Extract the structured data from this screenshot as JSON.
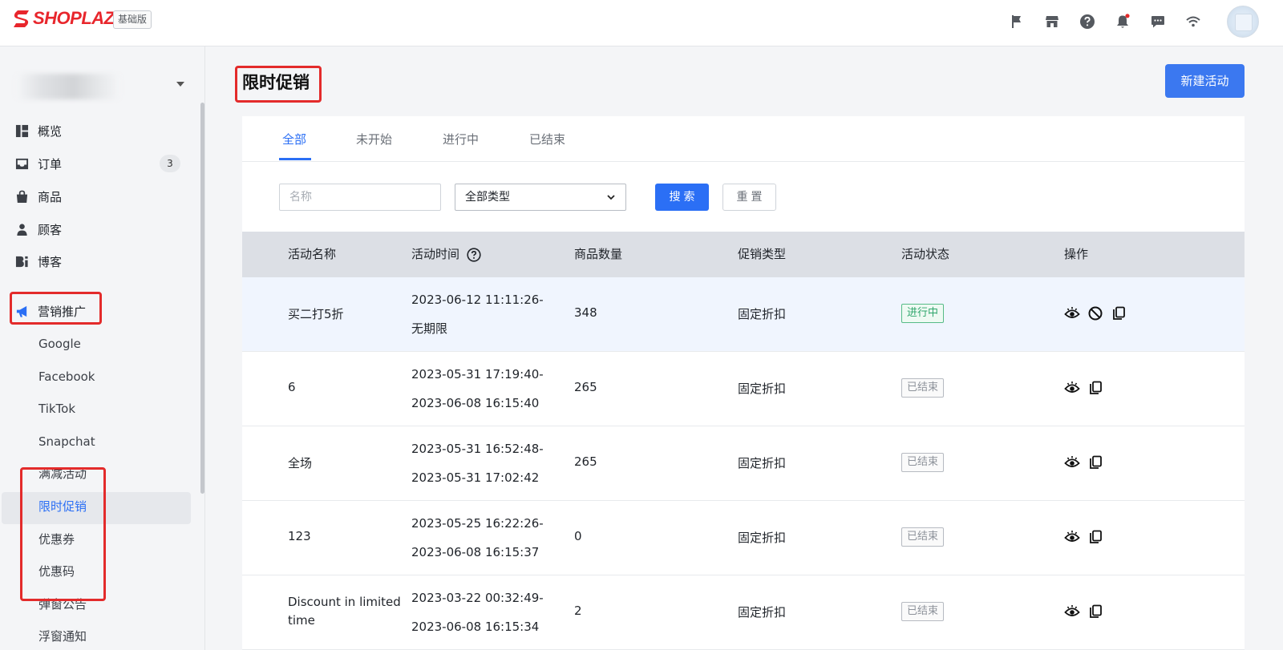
{
  "brand": {
    "name": "SHOPLAZZA",
    "plan": "基础版"
  },
  "topbar": {
    "icons": [
      "flag-icon",
      "store-icon",
      "help-icon",
      "bell-icon",
      "chat-icon",
      "wifi-icon"
    ]
  },
  "sidebar": {
    "nav": [
      {
        "label": "概览",
        "icon": "dashboard-icon"
      },
      {
        "label": "订单",
        "icon": "inbox-icon",
        "badge": "3"
      },
      {
        "label": "商品",
        "icon": "bag-icon"
      },
      {
        "label": "顾客",
        "icon": "person-icon"
      },
      {
        "label": "博客",
        "icon": "blog-icon"
      },
      {
        "label": "营销推广",
        "icon": "megaphone-icon"
      }
    ],
    "marketing_sub": [
      "Google",
      "Facebook",
      "TikTok",
      "Snapchat",
      "满减活动",
      "限时促销",
      "优惠券",
      "优惠码",
      "弹窗公告",
      "浮窗通知"
    ],
    "active_sub": "限时促销"
  },
  "page": {
    "title": "限时促销",
    "new_button": "新建活动"
  },
  "tabs": [
    "全部",
    "未开始",
    "进行中",
    "已结束"
  ],
  "active_tab": "全部",
  "filters": {
    "name_placeholder": "名称",
    "type_selected": "全部类型",
    "search_label": "搜索",
    "reset_label": "重置"
  },
  "table": {
    "columns": [
      "活动名称",
      "活动时间",
      "商品数量",
      "促销类型",
      "活动状态",
      "操作"
    ],
    "rows": [
      {
        "name": "买二打5折",
        "time_start": "2023-06-12 11:11:26-",
        "time_end": "无期限",
        "count": "348",
        "type": "固定折扣",
        "status": "进行中",
        "status_kind": "running"
      },
      {
        "name": "6",
        "time_start": "2023-05-31 17:19:40-",
        "time_end": "2023-06-08 16:15:40",
        "count": "265",
        "type": "固定折扣",
        "status": "已结束",
        "status_kind": "ended"
      },
      {
        "name": "全场",
        "time_start": "2023-05-31 16:52:48-",
        "time_end": "2023-05-31 17:02:42",
        "count": "265",
        "type": "固定折扣",
        "status": "已结束",
        "status_kind": "ended"
      },
      {
        "name": "123",
        "time_start": "2023-05-25 16:22:26-",
        "time_end": "2023-06-08 16:15:37",
        "count": "0",
        "type": "固定折扣",
        "status": "已结束",
        "status_kind": "ended"
      },
      {
        "name": "Discount in limited time",
        "time_start": "2023-03-22 00:32:49-",
        "time_end": "2023-06-08 16:15:34",
        "count": "2",
        "type": "固定折扣",
        "status": "已结束",
        "status_kind": "ended"
      }
    ]
  },
  "colors": {
    "brand_red": "#e8262c",
    "primary_blue": "#2b6ff5",
    "highlight_red": "#e32b2b",
    "running_green": "#2ea56b"
  }
}
